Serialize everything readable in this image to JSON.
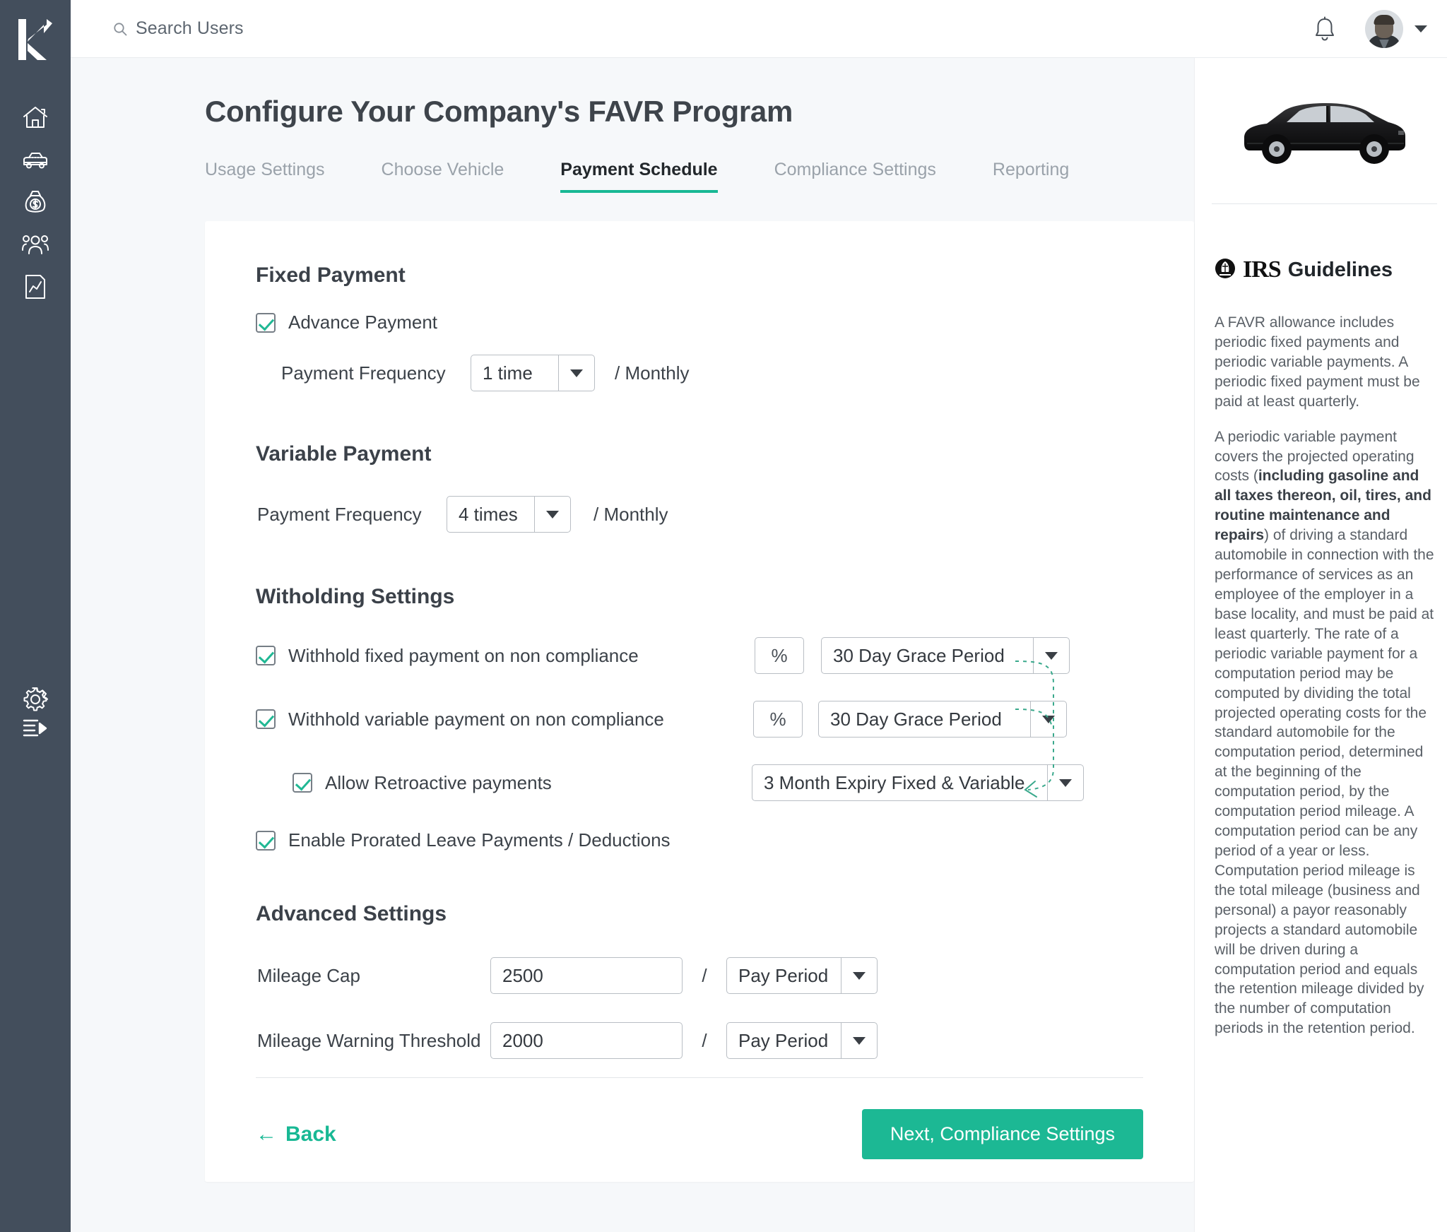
{
  "sidebar": {
    "logo_name": "kliq-logo",
    "items": [
      {
        "name": "home-icon",
        "label": "Home"
      },
      {
        "name": "car-icon",
        "label": "Vehicles"
      },
      {
        "name": "money-bag-icon",
        "label": "Payments"
      },
      {
        "name": "people-icon",
        "label": "Users"
      },
      {
        "name": "report-icon",
        "label": "Reports"
      }
    ],
    "bottom_items": [
      {
        "name": "gear-icon",
        "label": "Settings"
      },
      {
        "name": "collapse-icon",
        "label": "Collapse"
      }
    ]
  },
  "topbar": {
    "search_placeholder": "Search Users",
    "search_value": "",
    "bell_name": "notification-bell-icon",
    "avatar_name": "user-avatar",
    "caret_name": "chevron-down-icon"
  },
  "page": {
    "title": "Configure Your Company's FAVR Program"
  },
  "tabs": [
    {
      "label": "Usage Settings",
      "active": false
    },
    {
      "label": "Choose Vehicle",
      "active": false
    },
    {
      "label": "Payment Schedule",
      "active": true
    },
    {
      "label": "Compliance Settings",
      "active": false
    },
    {
      "label": "Reporting",
      "active": false
    }
  ],
  "fixed_payment": {
    "section_title": "Fixed Payment",
    "advance_payment_label": "Advance Payment",
    "advance_payment_checked": true,
    "frequency_label": "Payment Frequency",
    "frequency_value": "1 time",
    "frequency_suffix": "/ Monthly"
  },
  "variable_payment": {
    "section_title": "Variable Payment",
    "frequency_label": "Payment Frequency",
    "frequency_value": "4 times",
    "frequency_suffix": "/ Monthly"
  },
  "witholding": {
    "section_title": "Witholding Settings",
    "fixed_label": "Withhold fixed payment on non compliance",
    "fixed_checked": true,
    "fixed_percent_value": "%",
    "fixed_grace_value": "30 Day Grace Period",
    "variable_label": "Withhold variable payment on non compliance",
    "variable_checked": true,
    "variable_percent_value": "%",
    "variable_grace_value": "30 Day Grace Period",
    "retroactive_label": "Allow Retroactive payments",
    "retroactive_checked": true,
    "retroactive_expiry_value": "3 Month Expiry Fixed & Variable",
    "prorated_label": "Enable Prorated Leave Payments / Deductions",
    "prorated_checked": true,
    "connector_color": "#3aa98c"
  },
  "advanced": {
    "section_title": "Advanced Settings",
    "mileage_cap_label": "Mileage Cap",
    "mileage_cap_value": "2500",
    "mileage_cap_slash": "/",
    "mileage_cap_period": "Pay Period",
    "warning_label": "Mileage Warning Threshold",
    "warning_value": "2000",
    "warning_slash": "/",
    "warning_period": "Pay Period"
  },
  "footer": {
    "back_arrow": "←",
    "back_label": "Back",
    "next_label": "Next, Compliance Settings"
  },
  "panel": {
    "car_image_name": "black-sedan-car-image",
    "irs_logo_text": "IRS",
    "irs_title": "Guidelines",
    "paragraph1": "A FAVR allowance includes periodic fixed payments and periodic variable payments. A periodic fixed payment must be paid at least quarterly.",
    "paragraph2_part1": "A periodic variable payment covers the projected operating costs (",
    "paragraph2_bold": "including gasoline and all taxes thereon, oil, tires, and routine maintenance and repairs",
    "paragraph2_part2": ") of driving a standard automobile in connection with the performance of services as an employee of the employer in a base locality, and must be paid at least quarterly. The rate of a periodic variable payment for a computation period may be computed by dividing the total projected operating costs for the standard automobile for the computation period, determined at the beginning of the computation period, by the computation period mileage. A computation period can be any period of a year or less. Computation period mileage is the total mileage (business and personal) a payor reasonably projects a standard automobile will be driven during a computation period and equals the retention mileage divided by the number of computation periods in the retention period."
  },
  "colors": {
    "accent": "#1cb894",
    "sidebar_bg": "#434e5c",
    "page_bg": "#f6f8fa"
  }
}
